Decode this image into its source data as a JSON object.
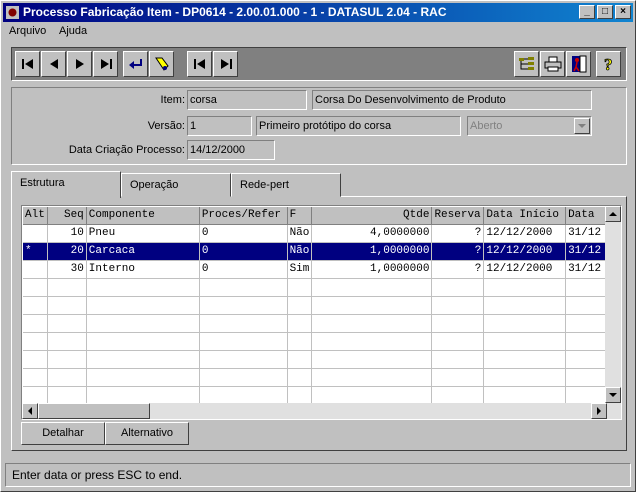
{
  "window": {
    "title": "Processo Fabricação Item - DP0614 - 2.00.01.000 - 1 - DATASUL 2.04 - RAC"
  },
  "menu": [
    "Arquivo",
    "Ajuda"
  ],
  "toolbar": {
    "nav_icons": [
      "first-record-icon",
      "previous-record-icon",
      "next-record-icon",
      "last-record-icon",
      "go-to-icon",
      "search-icon",
      "first-page-icon",
      "last-page-icon"
    ],
    "right_icons": [
      "structure-tree-icon",
      "print-icon",
      "exit-icon",
      "help-icon"
    ]
  },
  "header": {
    "item_label": "Item:",
    "item_value": "corsa",
    "item_desc": "Corsa Do Desenvolvimento de Produto",
    "versao_label": "Versão:",
    "versao_value": "1",
    "versao_desc": "Primeiro protótipo do corsa",
    "status_value": "Aberto",
    "data_label": "Data Criação Processo:",
    "data_value": "14/12/2000"
  },
  "tabs": [
    "Estrutura",
    "Operação",
    "Rede-pert"
  ],
  "grid": {
    "columns": [
      "Alt",
      "Seq",
      "Componente",
      "Proces/Refer",
      "F",
      "Qtde",
      "Reserva",
      "Data Início",
      "Data"
    ],
    "rows": [
      [
        "",
        "10",
        "Pneu",
        "0",
        "Não",
        "4,0000000",
        "?",
        "12/12/2000",
        "31/12"
      ],
      [
        "*",
        "20",
        "Carcaca",
        "0",
        "Não",
        "1,0000000",
        "?",
        "12/12/2000",
        "31/12"
      ],
      [
        "",
        "30",
        "Interno",
        "0",
        "Sim",
        "1,0000000",
        "?",
        "12/12/2000",
        "31/12"
      ]
    ],
    "selected_row": 1
  },
  "buttons": {
    "detalhar": "Detalhar",
    "alternativo": "Alternativo"
  },
  "status_text": "Enter data or press ESC to end."
}
